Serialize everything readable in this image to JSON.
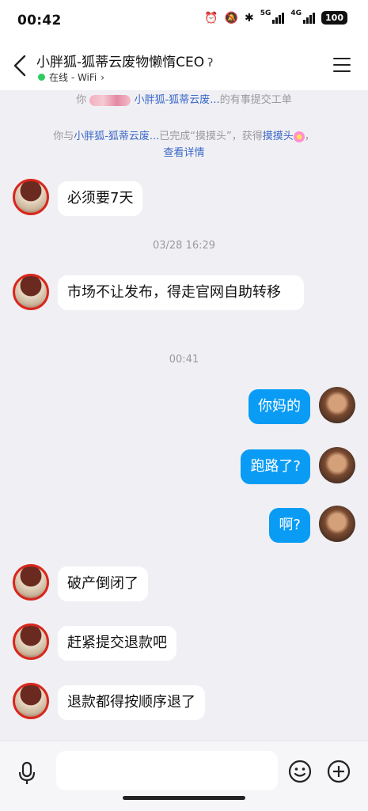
{
  "status_bar": {
    "time": "00:42",
    "network_5g": "5G",
    "network_4g": "4G",
    "battery": "100"
  },
  "header": {
    "title": "小胖狐-狐蒂云废物懒惰CEO",
    "status": "在线 - WiFi",
    "status_color": "#2ecc5e"
  },
  "system_notices": [
    {
      "prefix": "你",
      "name": "小胖狐-狐蒂云废...",
      "suffix": "的有事提交工单"
    },
    {
      "prefix": "你与",
      "name": "小胖狐-狐蒂云废...",
      "middle": "已完成“摸摸头”，获得",
      "reward": "摸摸头",
      "end": "，",
      "link": "查看详情"
    }
  ],
  "messages": [
    {
      "side": "in",
      "text": "必须要7天"
    },
    {
      "timestamp": "03/28 16:29"
    },
    {
      "side": "in",
      "text": "市场不让发布，得走官网自助转移"
    },
    {
      "timestamp": "00:41"
    },
    {
      "side": "out",
      "text": "你妈的"
    },
    {
      "side": "out",
      "text": "跑路了?"
    },
    {
      "side": "out",
      "text": "啊?"
    },
    {
      "side": "in",
      "text": "破产倒闭了"
    },
    {
      "side": "in",
      "text": "赶紧提交退款吧"
    },
    {
      "side": "in",
      "text": "退款都得按顺序退了"
    }
  ],
  "composer": {
    "value": ""
  },
  "colors": {
    "outgoing_bubble": "#0a9cf5",
    "link": "#3a67c6",
    "background": "#f0f0f4"
  }
}
